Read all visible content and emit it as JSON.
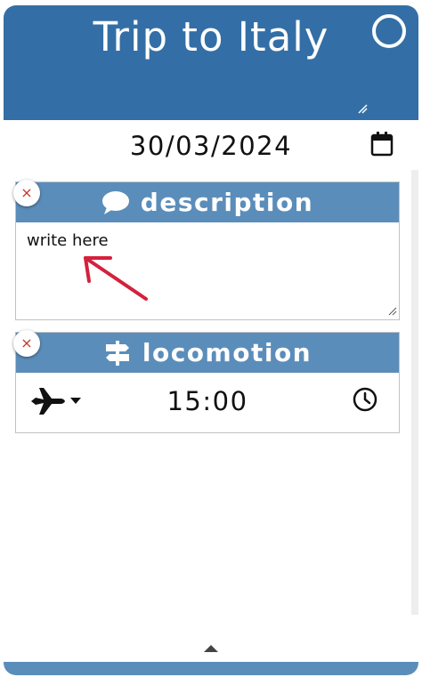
{
  "header": {
    "title": "Trip to Italy",
    "circle_icon": "circle-icon"
  },
  "date": {
    "value": "30/03/2024",
    "icon": "calendar-icon"
  },
  "sections": {
    "description": {
      "title": "description",
      "icon": "speech-bubble-icon",
      "remove_label": "×",
      "text": "write here"
    },
    "locomotion": {
      "title": "locomotion",
      "icon": "signpost-icon",
      "remove_label": "×",
      "mode_icon": "airplane-icon",
      "time": "15:00",
      "time_icon": "clock-icon"
    }
  },
  "colors": {
    "header": "#336fa6",
    "section_header": "#5b8dba",
    "remove_x": "#c0392b",
    "annotation_arrow": "#d4213d"
  }
}
